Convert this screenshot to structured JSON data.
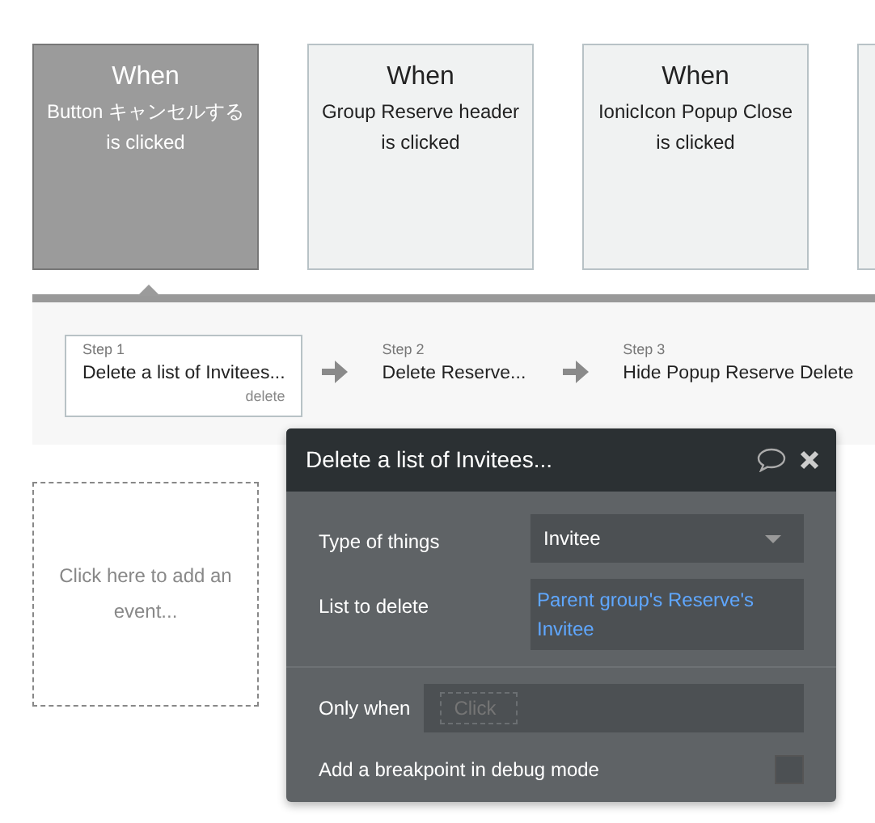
{
  "events": [
    {
      "title": "When",
      "description": "Button キャンセルする",
      "trigger": "is clicked",
      "selected": true
    },
    {
      "title": "When",
      "description": "Group Reserve header",
      "trigger": "is clicked",
      "selected": false
    },
    {
      "title": "When",
      "description": "IonicIcon Popup Close",
      "trigger": "is clicked",
      "selected": false
    },
    {
      "selected": false
    }
  ],
  "steps": [
    {
      "label": "Step 1",
      "action": "Delete a list of Invitees...",
      "delete": "delete",
      "selected": true
    },
    {
      "label": "Step 2",
      "action": "Delete Reserve...",
      "selected": false
    },
    {
      "label": "Step 3",
      "action": "Hide Popup Reserve Delete",
      "selected": false
    }
  ],
  "add_event": "Click here to add an event...",
  "popup": {
    "title": "Delete a list of Invitees...",
    "fields": [
      {
        "kind": "dropdown",
        "label": "Type of things",
        "value": "Invitee"
      },
      {
        "kind": "expression",
        "label": "List to delete",
        "value": "Parent group's Reserve's Invitee"
      }
    ],
    "only_when": {
      "label": "Only when",
      "placeholder": "Click"
    },
    "breakpoint": {
      "label": "Add a breakpoint in debug mode",
      "checked": false
    }
  }
}
